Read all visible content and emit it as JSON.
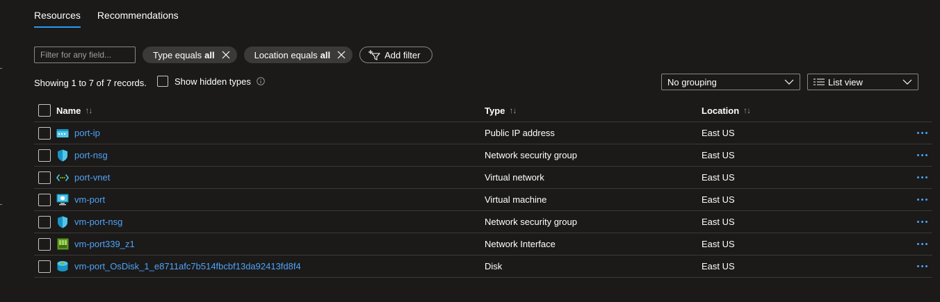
{
  "tabs": [
    {
      "label": "Resources",
      "active": true
    },
    {
      "label": "Recommendations",
      "active": false
    }
  ],
  "filter": {
    "placeholder": "Filter for any field...",
    "value": ""
  },
  "pills": [
    {
      "label": "Type equals",
      "value": "all"
    },
    {
      "label": "Location equals",
      "value": "all"
    }
  ],
  "add_filter_label": "Add filter",
  "records_text": "Showing 1 to 7 of 7 records.",
  "show_hidden_label": "Show hidden types",
  "grouping": {
    "selected": "No grouping"
  },
  "view": {
    "selected": "List view"
  },
  "columns": {
    "name": "Name",
    "type": "Type",
    "location": "Location"
  },
  "rows": [
    {
      "name": "port-ip",
      "type": "Public IP address",
      "location": "East US",
      "icon": "public-ip-icon"
    },
    {
      "name": "port-nsg",
      "type": "Network security group",
      "location": "East US",
      "icon": "nsg-shield-icon"
    },
    {
      "name": "port-vnet",
      "type": "Virtual network",
      "location": "East US",
      "icon": "vnet-icon"
    },
    {
      "name": "vm-port",
      "type": "Virtual machine",
      "location": "East US",
      "icon": "virtual-machine-icon"
    },
    {
      "name": "vm-port-nsg",
      "type": "Network security group",
      "location": "East US",
      "icon": "nsg-shield-icon"
    },
    {
      "name": "vm-port339_z1",
      "type": "Network Interface",
      "location": "East US",
      "icon": "network-interface-icon"
    },
    {
      "name": "vm-port_OsDisk_1_e8711afc7b514fbcbf13da92413fd8f4",
      "type": "Disk",
      "location": "East US",
      "icon": "disk-icon"
    }
  ],
  "colors": {
    "background": "#1b1a19",
    "accent": "#2899f5",
    "link": "#4fa3f7",
    "pill": "#3b3a39"
  }
}
